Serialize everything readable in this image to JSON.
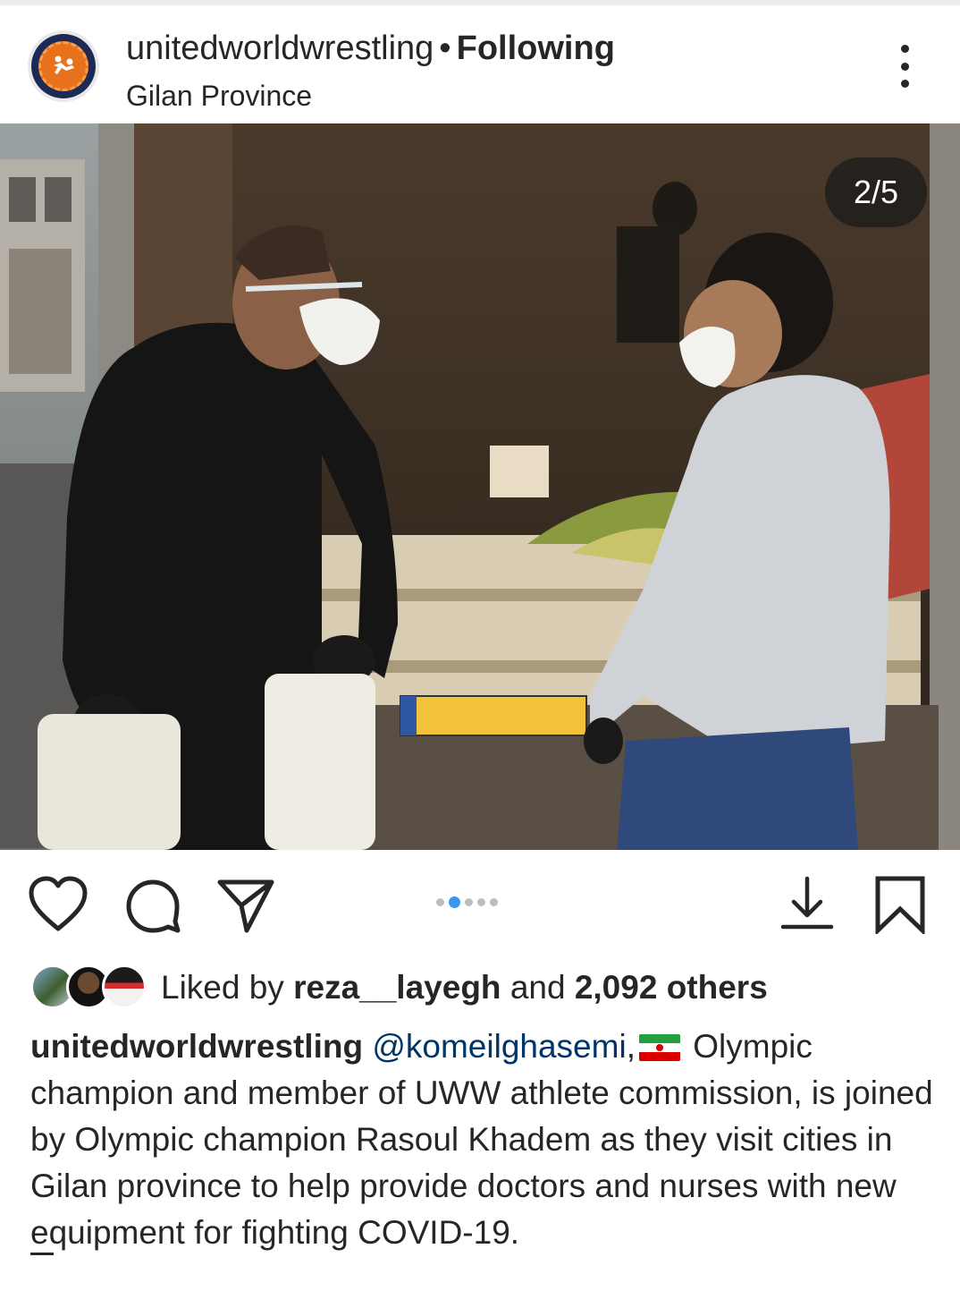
{
  "header": {
    "username": "unitedworldwrestling",
    "separator": "•",
    "follow_status": "Following",
    "location": "Gilan Province"
  },
  "post": {
    "carousel_counter": "2/5",
    "carousel": {
      "total": 5,
      "active_index": 1
    }
  },
  "actions": {
    "like_icon": "heart-icon",
    "comment_icon": "comment-icon",
    "share_icon": "send-icon",
    "download_icon": "download-icon",
    "save_icon": "bookmark-icon"
  },
  "likes": {
    "prefix": "Liked by",
    "liker": "reza__layegh",
    "conjunction": "and",
    "others": "2,092 others"
  },
  "caption": {
    "username": "unitedworldwrestling",
    "mention": "@komeilghasemi",
    "after_mention": ",",
    "text": "Olympic champion and member of UWW athlete commission, is joined by Olympic champion Rasoul Khadem as they visit cities in Gilan province to help provide doctors and nurses with new equipment for fighting COVID-19."
  },
  "colors": {
    "accent_blue": "#3897f0",
    "mention": "#003569",
    "text": "#262626",
    "brand_orange": "#e8721c"
  }
}
